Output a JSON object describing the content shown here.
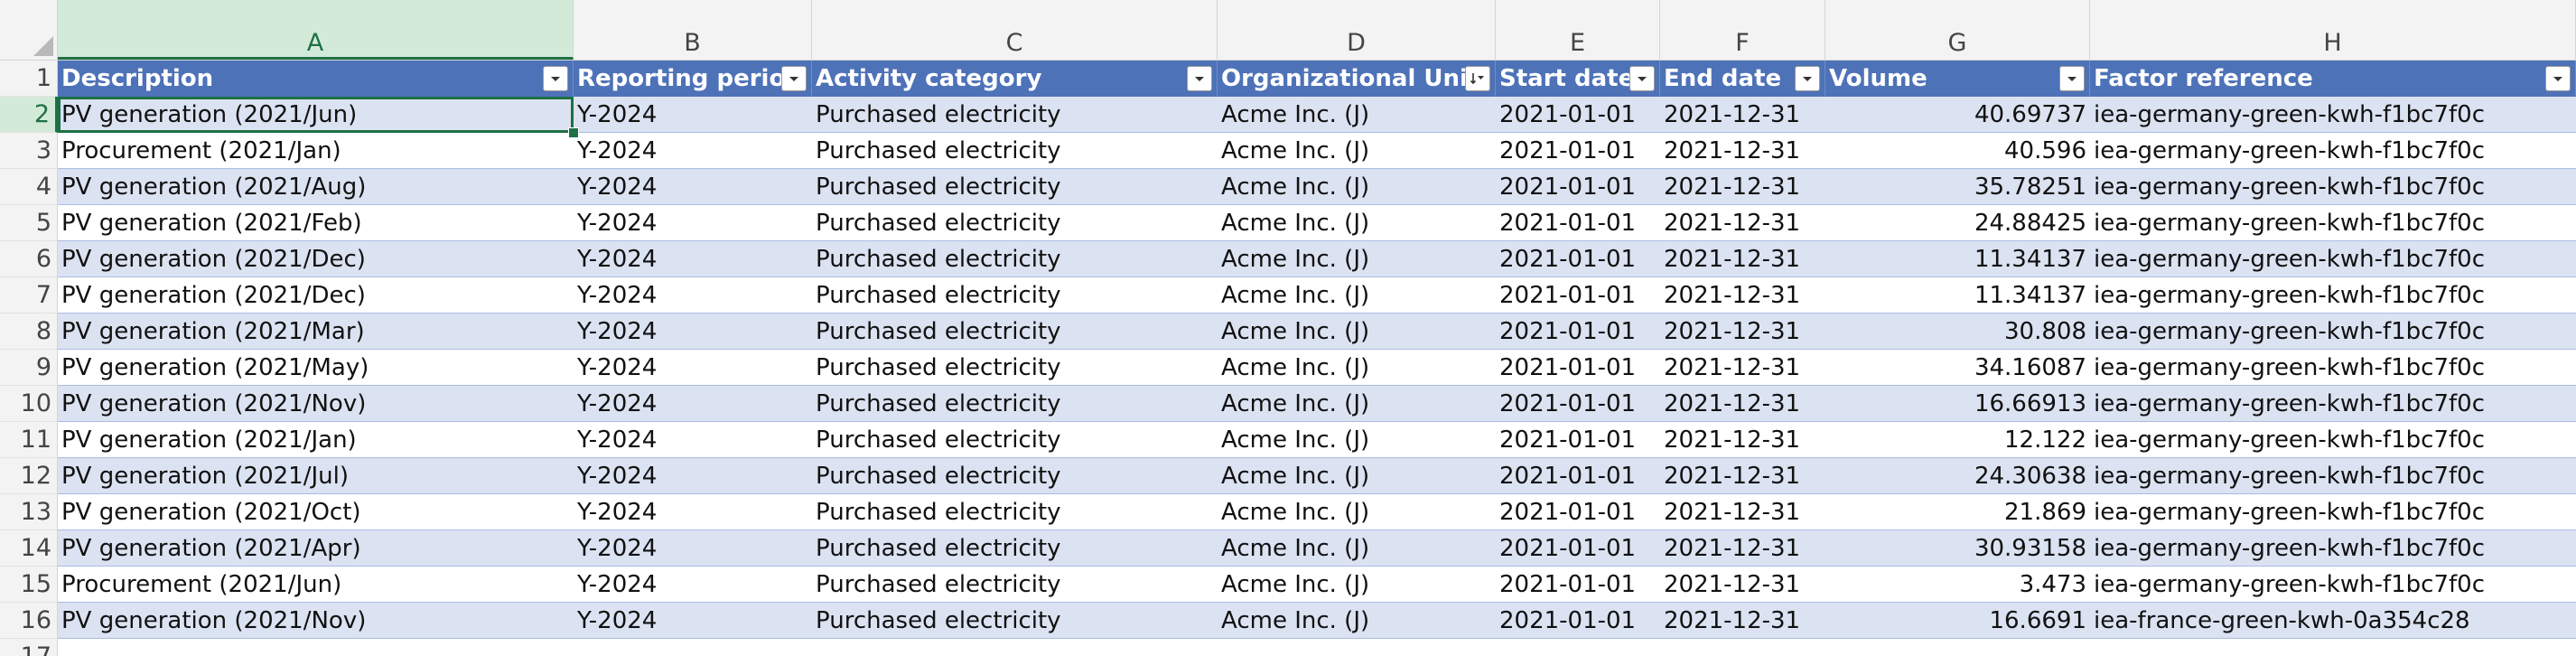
{
  "columns": [
    "A",
    "B",
    "C",
    "D",
    "E",
    "F",
    "G",
    "H"
  ],
  "row_numbers": [
    "1",
    "2",
    "3",
    "4",
    "5",
    "6",
    "7",
    "8",
    "9",
    "10",
    "11",
    "12",
    "13",
    "14",
    "15",
    "16",
    "17"
  ],
  "headers": [
    "Description",
    "Reporting period",
    "Activity category",
    "Organizational Unit",
    "Start date",
    "End date",
    "Volume",
    "Factor reference"
  ],
  "rows": [
    [
      "PV generation (2021/Jun)",
      "Y-2024",
      "Purchased electricity",
      "Acme Inc. (J)",
      "2021-01-01",
      "2021-12-31",
      "40.69737",
      "iea-germany-green-kwh-f1bc7f0c"
    ],
    [
      "Procurement (2021/Jan)",
      "Y-2024",
      "Purchased electricity",
      "Acme Inc. (J)",
      "2021-01-01",
      "2021-12-31",
      "40.596",
      "iea-germany-green-kwh-f1bc7f0c"
    ],
    [
      "PV generation (2021/Aug)",
      "Y-2024",
      "Purchased electricity",
      "Acme Inc. (J)",
      "2021-01-01",
      "2021-12-31",
      "35.78251",
      "iea-germany-green-kwh-f1bc7f0c"
    ],
    [
      "PV generation (2021/Feb)",
      "Y-2024",
      "Purchased electricity",
      "Acme Inc. (J)",
      "2021-01-01",
      "2021-12-31",
      "24.88425",
      "iea-germany-green-kwh-f1bc7f0c"
    ],
    [
      "PV generation (2021/Dec)",
      "Y-2024",
      "Purchased electricity",
      "Acme Inc. (J)",
      "2021-01-01",
      "2021-12-31",
      "11.34137",
      "iea-germany-green-kwh-f1bc7f0c"
    ],
    [
      "PV generation (2021/Dec)",
      "Y-2024",
      "Purchased electricity",
      "Acme Inc. (J)",
      "2021-01-01",
      "2021-12-31",
      "11.34137",
      "iea-germany-green-kwh-f1bc7f0c"
    ],
    [
      "PV generation (2021/Mar)",
      "Y-2024",
      "Purchased electricity",
      "Acme Inc. (J)",
      "2021-01-01",
      "2021-12-31",
      "30.808",
      "iea-germany-green-kwh-f1bc7f0c"
    ],
    [
      "PV generation (2021/May)",
      "Y-2024",
      "Purchased electricity",
      "Acme Inc. (J)",
      "2021-01-01",
      "2021-12-31",
      "34.16087",
      "iea-germany-green-kwh-f1bc7f0c"
    ],
    [
      "PV generation (2021/Nov)",
      "Y-2024",
      "Purchased electricity",
      "Acme Inc. (J)",
      "2021-01-01",
      "2021-12-31",
      "16.66913",
      "iea-germany-green-kwh-f1bc7f0c"
    ],
    [
      "PV generation (2021/Jan)",
      "Y-2024",
      "Purchased electricity",
      "Acme Inc. (J)",
      "2021-01-01",
      "2021-12-31",
      "12.122",
      "iea-germany-green-kwh-f1bc7f0c"
    ],
    [
      "PV generation (2021/Jul)",
      "Y-2024",
      "Purchased electricity",
      "Acme Inc. (J)",
      "2021-01-01",
      "2021-12-31",
      "24.30638",
      "iea-germany-green-kwh-f1bc7f0c"
    ],
    [
      "PV generation (2021/Oct)",
      "Y-2024",
      "Purchased electricity",
      "Acme Inc. (J)",
      "2021-01-01",
      "2021-12-31",
      "21.869",
      "iea-germany-green-kwh-f1bc7f0c"
    ],
    [
      "PV generation (2021/Apr)",
      "Y-2024",
      "Purchased electricity",
      "Acme Inc. (J)",
      "2021-01-01",
      "2021-12-31",
      "30.93158",
      "iea-germany-green-kwh-f1bc7f0c"
    ],
    [
      "Procurement (2021/Jun)",
      "Y-2024",
      "Purchased electricity",
      "Acme Inc. (J)",
      "2021-01-01",
      "2021-12-31",
      "3.473",
      "iea-germany-green-kwh-f1bc7f0c"
    ],
    [
      "PV generation (2021/Nov)",
      "Y-2024",
      "Purchased electricity",
      "Acme Inc. (J)",
      "2021-01-01",
      "2021-12-31",
      "16.6691",
      "iea-france-green-kwh-0a354c28"
    ]
  ],
  "selected_cell": "A2",
  "sorted_column": "D",
  "icons": {
    "filter": "filter-dropdown-icon",
    "sort": "sort-filter-icon",
    "corner": "select-all-icon"
  },
  "colors": {
    "header_bg": "#4e72b8",
    "band_bg": "#dbe2f1",
    "selection": "#1e7145"
  }
}
